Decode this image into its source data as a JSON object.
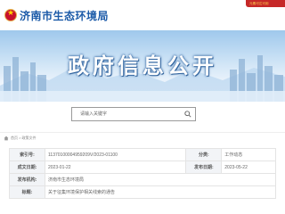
{
  "header": {
    "site_name": "济南市生态环境局",
    "top_badge": "元素可达可用"
  },
  "banner": {
    "title": "政府信息公开"
  },
  "search": {
    "placeholder": "请输入关键字"
  },
  "breadcrumb": {
    "text": "首页 > 政策文件"
  },
  "info": {
    "rows": [
      {
        "label_1": "索引号:",
        "value_1": "11370100004959209V/2023-01100",
        "label_2": "分类:",
        "value_2": "工作动态"
      },
      {
        "label_1": "成文日期:",
        "value_1": "2023-01-22",
        "label_2": "发布日期:",
        "value_2": "2023-05-22"
      },
      {
        "label_1": "发布机构:",
        "value_1": "济南市生态环境局"
      },
      {
        "label_1": "标题:",
        "value_1": "关于征集环境保护相关线索的通告"
      }
    ]
  },
  "colors": {
    "brand_blue": "#1b5aa8",
    "badge_red": "#c62828"
  }
}
